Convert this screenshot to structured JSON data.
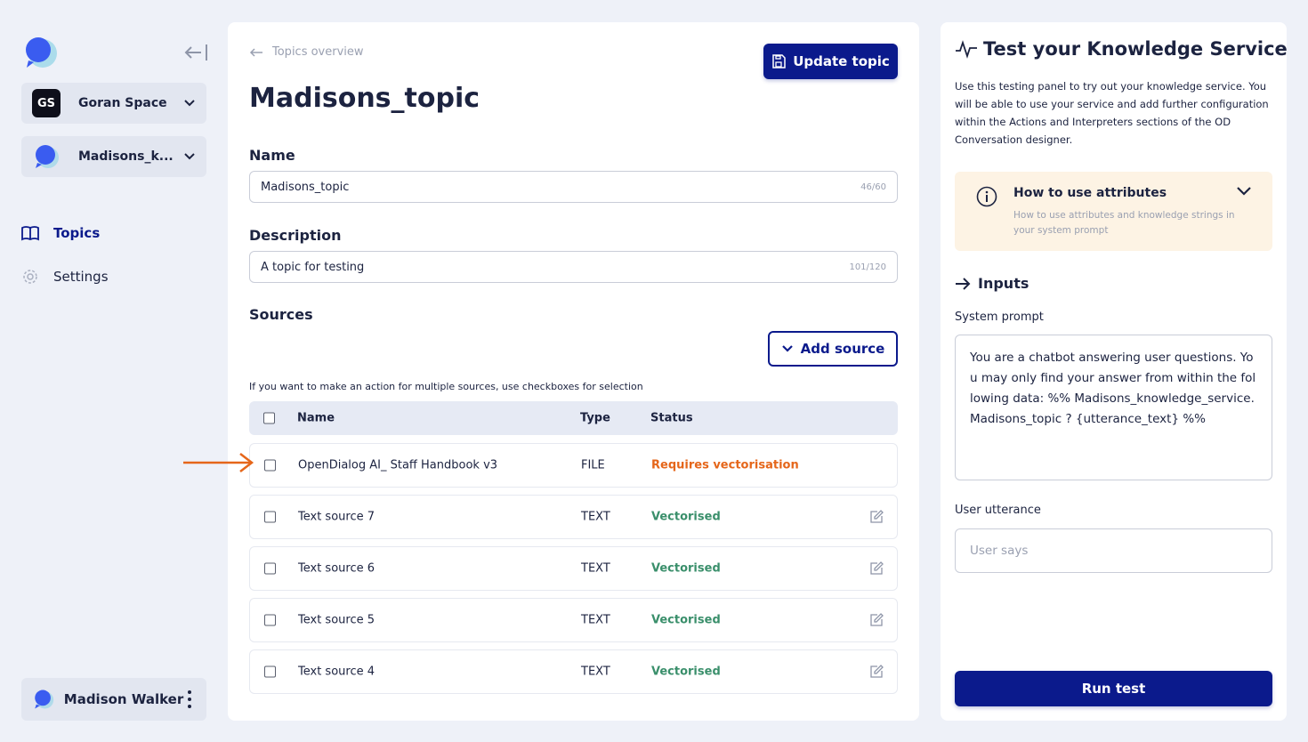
{
  "sidebar": {
    "workspace": {
      "badge": "GS",
      "name": "Goran Space"
    },
    "service": {
      "name": "Madisons_k..."
    },
    "nav": [
      {
        "label": "Topics",
        "icon": "book-icon",
        "active": true
      },
      {
        "label": "Settings",
        "icon": "gear-icon",
        "active": false
      }
    ],
    "user": {
      "name": "Madison Walker"
    }
  },
  "main": {
    "breadcrumb": "Topics overview",
    "update_button": "Update topic",
    "title": "Madisons_topic",
    "name_label": "Name",
    "name_value": "Madisons_topic",
    "name_counter": "46/60",
    "description_label": "Description",
    "description_value": "A topic for testing",
    "description_counter": "101/120",
    "sources_label": "Sources",
    "add_source_button": "Add source",
    "hint": "If you want to make an action for multiple sources, use checkboxes for selection",
    "table": {
      "columns": [
        "Name",
        "Type",
        "Status"
      ],
      "rows": [
        {
          "name": "OpenDialog AI_ Staff Handbook v3",
          "type": "FILE",
          "status": "Requires vectorisation",
          "status_kind": "warning",
          "editable": false
        },
        {
          "name": "Text source 7",
          "type": "TEXT",
          "status": "Vectorised",
          "status_kind": "ok",
          "editable": true
        },
        {
          "name": "Text source 6",
          "type": "TEXT",
          "status": "Vectorised",
          "status_kind": "ok",
          "editable": true
        },
        {
          "name": "Text source 5",
          "type": "TEXT",
          "status": "Vectorised",
          "status_kind": "ok",
          "editable": true
        },
        {
          "name": "Text source 4",
          "type": "TEXT",
          "status": "Vectorised",
          "status_kind": "ok",
          "editable": true
        }
      ]
    }
  },
  "panel": {
    "title": "Test your Knowledge Service",
    "description": "Use this testing panel to try out your knowledge service. You will be able to use your service and add further configuration within the Actions and Interpreters sections of the OD Conversation designer.",
    "attributes_title": "How to use attributes",
    "attributes_sub": "How to use attributes and knowledge strings in your system prompt",
    "inputs_label": "Inputs",
    "system_prompt_label": "System prompt",
    "system_prompt_value": "You are a chatbot answering user questions. You may only find your answer from within the following data: %% Madisons_knowledge_service.Madisons_topic ? {utterance_text} %%",
    "utterance_label": "User utterance",
    "utterance_placeholder": "User says",
    "run_button": "Run test"
  },
  "colors": {
    "primary": "#0b1a8c",
    "warning": "#e5661a",
    "success": "#3a8f6b",
    "annotation_arrow": "#e5661a"
  }
}
